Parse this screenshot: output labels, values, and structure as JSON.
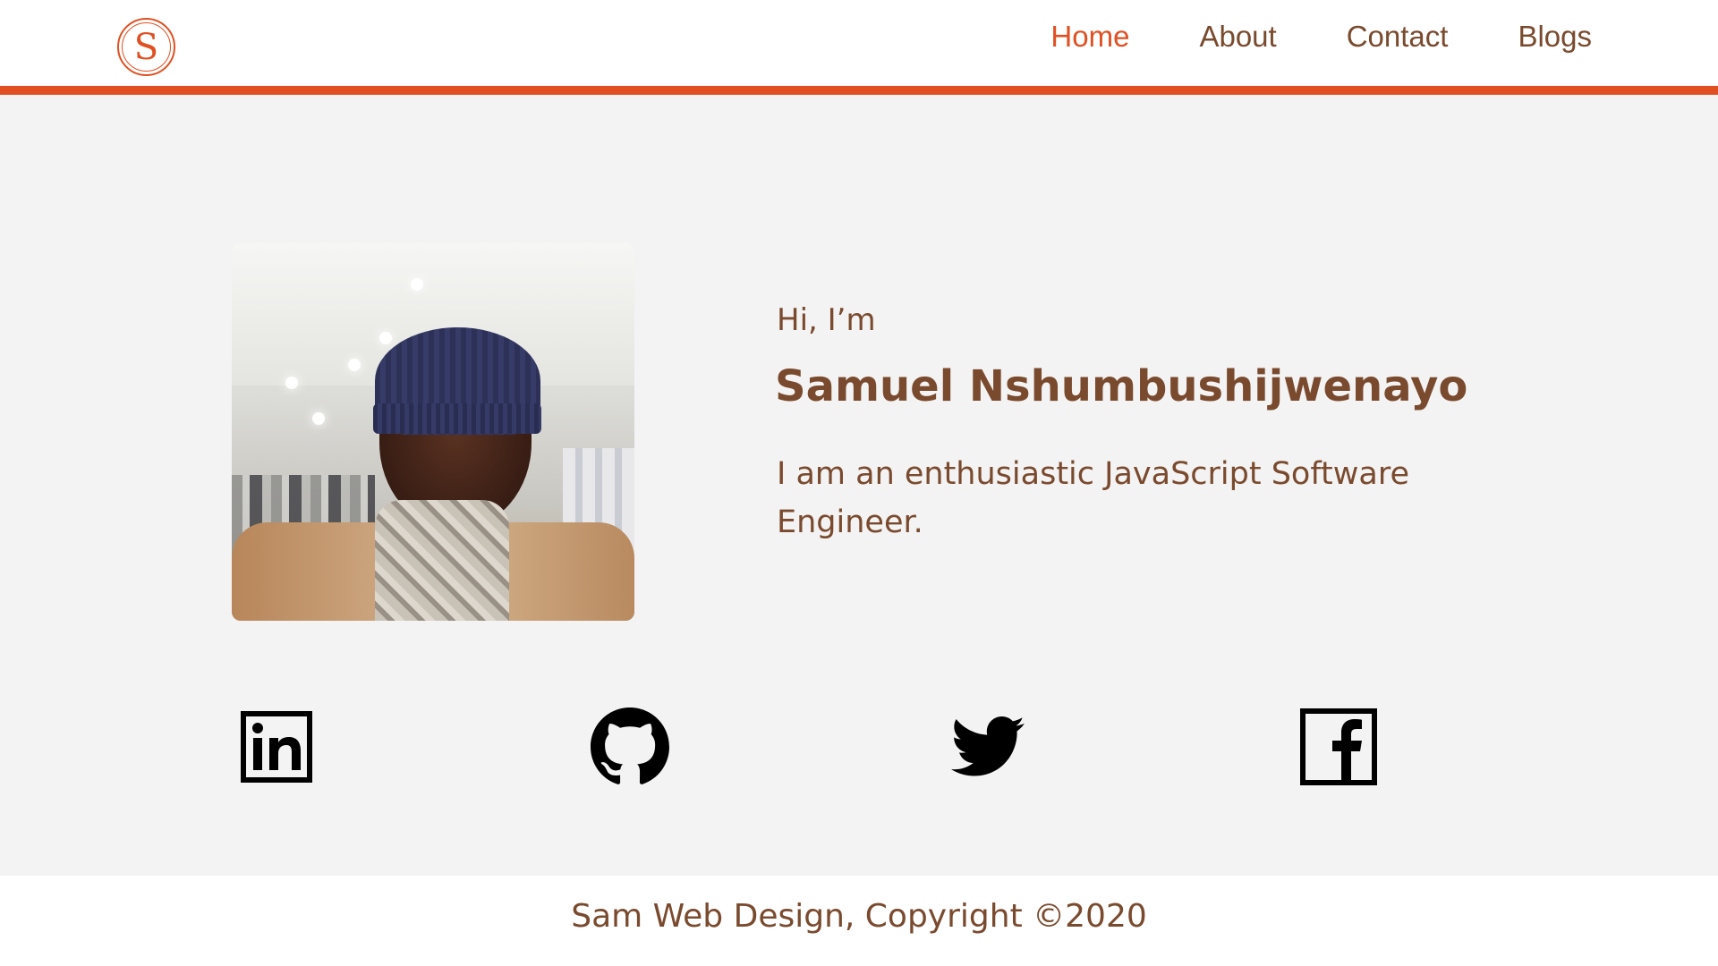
{
  "header": {
    "logo_letter": "S",
    "nav": [
      {
        "label": "Home",
        "active": true
      },
      {
        "label": "About",
        "active": false
      },
      {
        "label": "Contact",
        "active": false
      },
      {
        "label": "Blogs",
        "active": false
      }
    ]
  },
  "hero": {
    "greeting": "Hi, I’m",
    "name": "Samuel Nshumbushijwenayo",
    "tagline": "I am an enthusiastic JavaScript Software Engineer."
  },
  "social": [
    {
      "icon": "linkedin-icon"
    },
    {
      "icon": "github-icon"
    },
    {
      "icon": "twitter-icon"
    },
    {
      "icon": "facebook-icon"
    }
  ],
  "footer": {
    "text": "Sam Web Design, Copyright ©2020"
  },
  "colors": {
    "accent": "#e05022",
    "text": "#7a4a2e",
    "background": "#f3f3f3"
  }
}
